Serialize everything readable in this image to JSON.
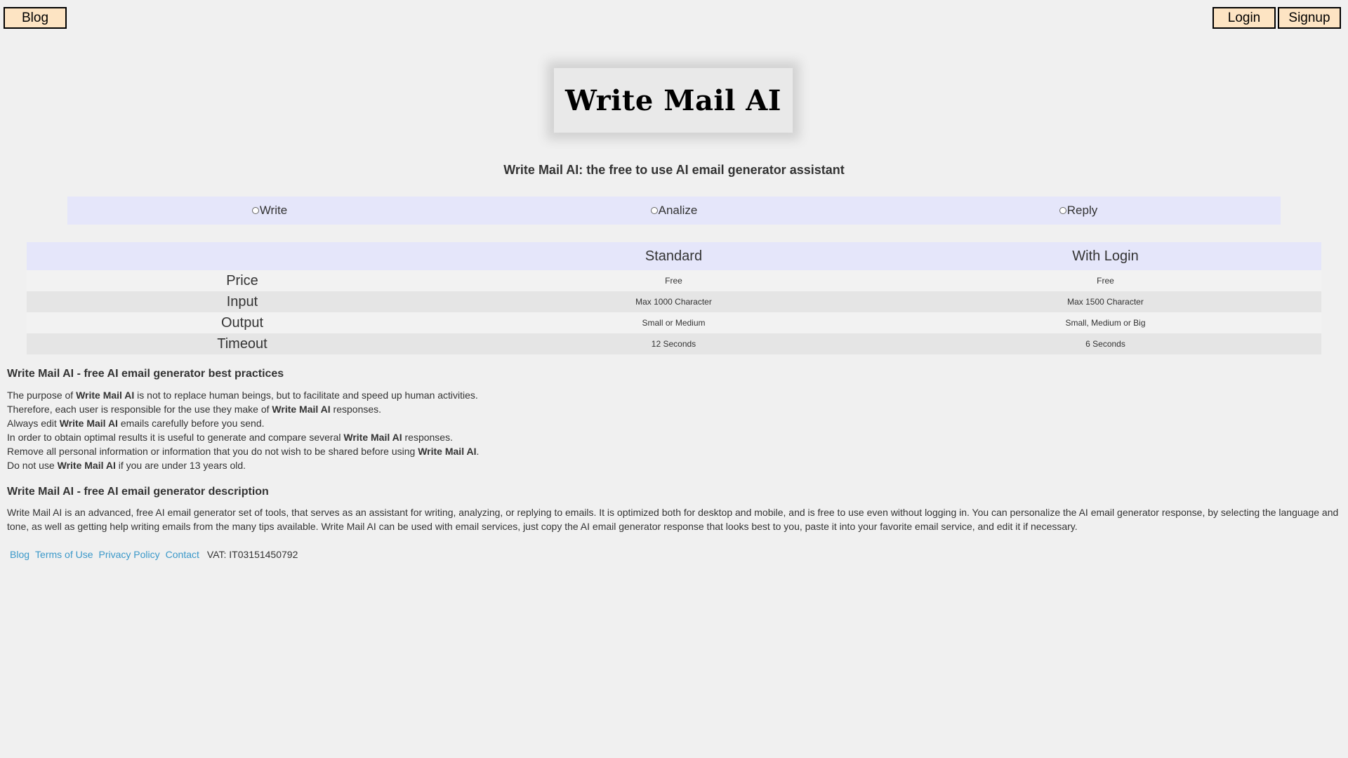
{
  "nav": {
    "blog_label": "Blog",
    "login_label": "Login",
    "signup_label": "Signup"
  },
  "logo": {
    "text": "Write Mail AI"
  },
  "subtitle": "Write Mail AI: the free to use AI email generator assistant",
  "modes": [
    {
      "label": "Write",
      "selected": false
    },
    {
      "label": "Analize",
      "selected": false
    },
    {
      "label": "Reply",
      "selected": false
    }
  ],
  "pricing": {
    "headers": [
      "",
      "Standard",
      "With Login"
    ],
    "rows": [
      {
        "label": "Price",
        "standard": "Free",
        "with_login": "Free"
      },
      {
        "label": "Input",
        "standard": "Max 1000 Character",
        "with_login": "Max 1500 Character"
      },
      {
        "label": "Output",
        "standard": "Small or Medium",
        "with_login": "Small, Medium or Big"
      },
      {
        "label": "Timeout",
        "standard": "12 Seconds",
        "with_login": "6 Seconds"
      }
    ]
  },
  "best_practices": {
    "heading": "Write Mail AI - free AI email generator best practices",
    "brand": "Write Mail AI",
    "lines": [
      {
        "pre": "The purpose of ",
        "post": " is not to replace human beings, but to facilitate and speed up human activities."
      },
      {
        "pre": "Therefore, each user is responsible for the use they make of ",
        "post": " responses."
      },
      {
        "pre": "Always edit ",
        "post": " emails carefully before you send."
      },
      {
        "pre": "In order to obtain optimal results it is useful to generate and compare several ",
        "post": " responses."
      },
      {
        "pre": "Remove all personal information or information that you do not wish to be shared before using ",
        "post": "."
      },
      {
        "pre": "Do not use ",
        "post": " if you are under 13 years old."
      }
    ]
  },
  "description": {
    "heading": "Write Mail AI - free AI email generator description",
    "text": "Write Mail AI is an advanced, free AI email generator set of tools, that serves as an assistant for writing, analyzing, or replying to emails. It is optimized both for desktop and mobile, and is free to use even without logging in. You can personalize the AI email generator response, by selecting the language and tone, as well as getting help writing emails from the many tips available. Write Mail AI can be used with email services, just copy the AI email generator response that looks best to you, paste it into your favorite email service, and edit it if necessary."
  },
  "footer": {
    "blog": "Blog",
    "terms": "Terms of Use",
    "privacy": "Privacy Policy",
    "contact": "Contact",
    "vat": "VAT: IT03151450792"
  }
}
